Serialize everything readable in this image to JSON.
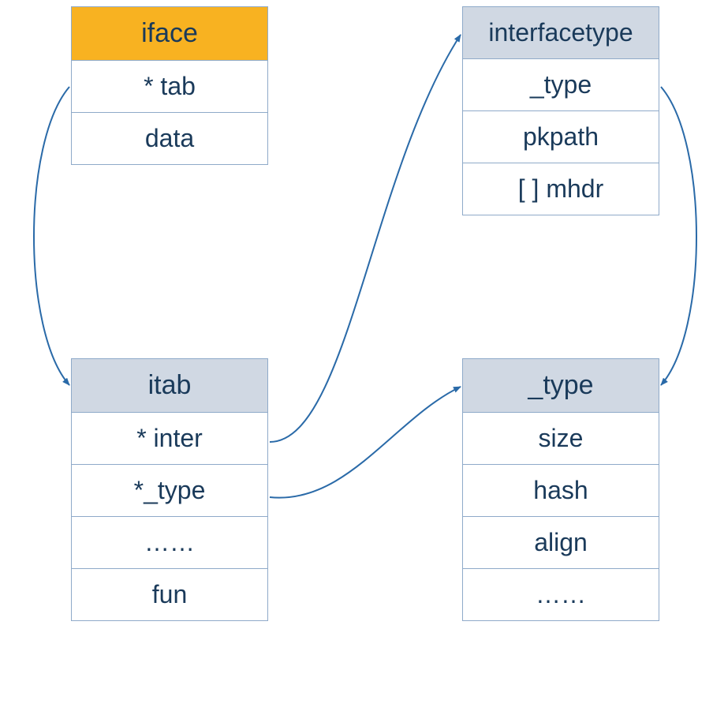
{
  "boxes": {
    "iface": {
      "title": "iface",
      "rows": [
        "* tab",
        "data"
      ]
    },
    "interfacetype": {
      "title": "interfacetype",
      "rows": [
        "_type",
        "pkpath",
        "[ ] mhdr"
      ]
    },
    "itab": {
      "title": "itab",
      "rows": [
        "* inter",
        "*_type",
        "……",
        "fun"
      ]
    },
    "type": {
      "title": "_type",
      "rows": [
        "size",
        "hash",
        "align",
        "……"
      ]
    }
  }
}
